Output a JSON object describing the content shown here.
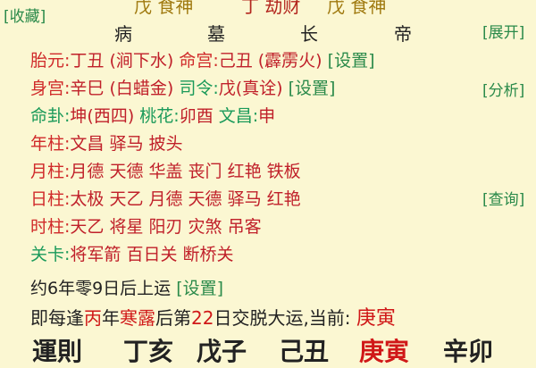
{
  "links": {
    "collect": "[收藏]",
    "expand": "[展开]",
    "analyze": "[分析]",
    "query": "[查询]"
  },
  "top_row": [
    "戊 食神",
    "丁 劫财",
    "戊 食神"
  ],
  "stages": [
    "病",
    "墓",
    "长",
    "帝"
  ],
  "rows": {
    "taiyuan": {
      "label": "胎元:",
      "value": "丁丑 (涧下水)"
    },
    "minggong": {
      "label": "命宫:",
      "value": "己丑 (霹雳火)"
    },
    "set1": "[设置]",
    "shengong": {
      "label": "身宫:",
      "value": "辛巳 (白蜡金)"
    },
    "siling": {
      "label": "司令:",
      "value": "戊(真诠)"
    },
    "set2": "[设置]",
    "minggua": {
      "label": "命卦:",
      "value": "坤(西四)"
    },
    "taohua": {
      "label": "桃花:",
      "value": "卯酉"
    },
    "wenchang": {
      "label": "文昌:",
      "value": "申"
    },
    "nianzhu": {
      "label": "年柱:",
      "value": "文昌  驿马  披头"
    },
    "yuezhu": {
      "label": "月柱:",
      "value": "月德  天德  华盖  丧门  红艳  铁板"
    },
    "rizhu": {
      "label": "日柱:",
      "value": "太极  天乙  月德  天德  驿马  红艳"
    },
    "shizhu": {
      "label": "时柱:",
      "value": "天乙  将星  阳刃  灾煞  吊客"
    },
    "guanka": {
      "label": "关卡:",
      "value": "将军箭  百日关  断桥关"
    }
  },
  "yun": {
    "start": "约6年零9日后上运",
    "set3": "[设置]",
    "prefix": "即每逢",
    "bing": "丙",
    "nian": "年",
    "hanlu": "寒露",
    "hou": "后第",
    "num": "22",
    "suffix": "日交脱大运,当前:",
    "current": "庚寅"
  },
  "dayun": [
    "運則",
    "丁亥",
    "戊子",
    "己丑",
    "庚寅",
    "辛卯"
  ]
}
